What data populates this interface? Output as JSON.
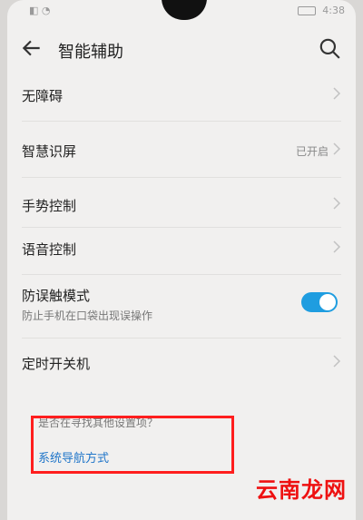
{
  "status_bar": {
    "left": "◧ ◔",
    "time": "4:38"
  },
  "app_bar": {
    "title": "智能辅助"
  },
  "menu": [
    {
      "label": "无障碍"
    },
    {
      "label": "智慧识屏",
      "value": "已开启"
    },
    {
      "label": "手势控制"
    },
    {
      "label": "语音控制"
    },
    {
      "label": "防误触模式",
      "subtitle": "防止手机在口袋出现误操作",
      "toggle_on": true
    },
    {
      "label": "定时开关机"
    }
  ],
  "suggestions": {
    "question": "是否在寻找其他设置项？",
    "link": "系统导航方式"
  },
  "watermark": "云南龙网",
  "colors": {
    "accent": "#1f9de0",
    "highlight": "#ff1e1e",
    "link": "#1f75c9"
  }
}
